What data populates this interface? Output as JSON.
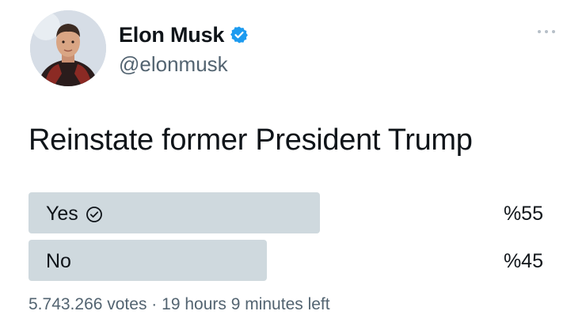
{
  "author": {
    "display_name": "Elon Musk",
    "handle": "@elonmusk",
    "verified_icon": "verified-badge-icon",
    "avatar": "profile-photo"
  },
  "more_icon": "more-options-icon",
  "tweet": {
    "text": "Reinstate former President Trump"
  },
  "poll": {
    "options": [
      {
        "label": "Yes",
        "percent_label": "%55",
        "percent": 55,
        "selected_icon": "check-circle-icon"
      },
      {
        "label": "No",
        "percent_label": "%45",
        "percent": 45
      }
    ],
    "votes": "5.743.266 votes",
    "separator": "·",
    "time_left": "19 hours 9 minutes left",
    "bar_color": "#cfd9de"
  },
  "colors": {
    "verified": "#1d9bf0",
    "text": "#0f1419",
    "secondary": "#536471"
  }
}
